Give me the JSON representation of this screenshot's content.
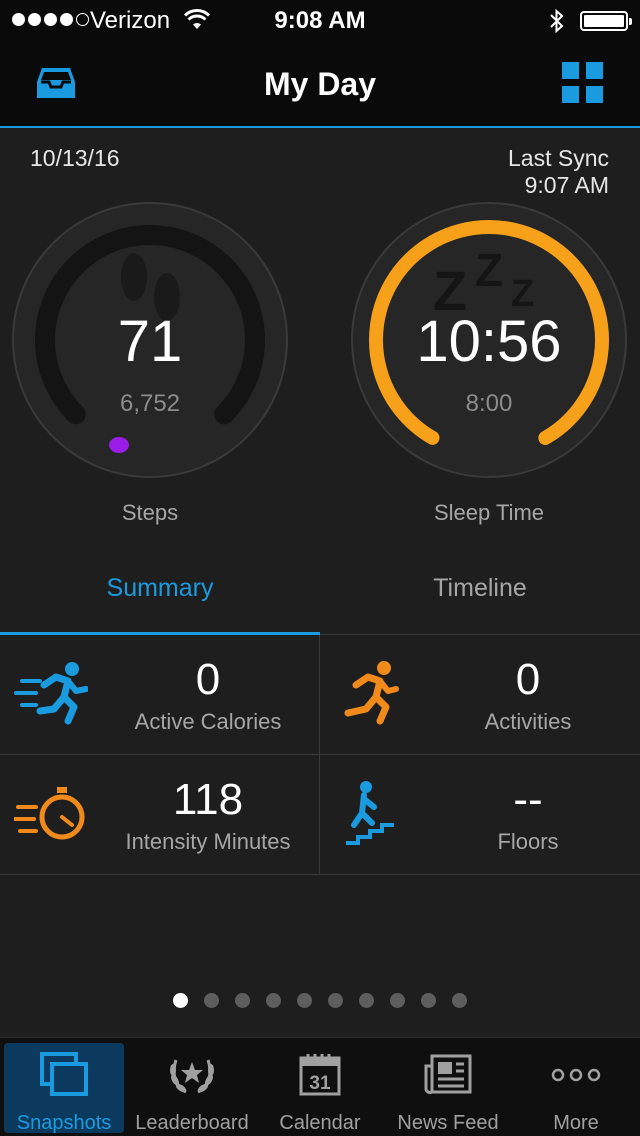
{
  "status_bar": {
    "carrier": "Verizon",
    "time": "9:08 AM",
    "signal_bars": 4,
    "signal_max": 5,
    "battery_level": 1.0
  },
  "nav": {
    "title": "My Day",
    "left_icon": "inbox-icon",
    "right_icon": "grid-icon"
  },
  "header": {
    "date": "10/13/16",
    "sync_label": "Last Sync",
    "sync_time": "9:07 AM"
  },
  "gauges": {
    "steps": {
      "value": "71",
      "goal": "6,752",
      "label": "Steps",
      "progress": 0.0105,
      "icon": "footprints-icon",
      "color": "#9b1ce6"
    },
    "sleep": {
      "value": "10:56",
      "goal": "8:00",
      "label": "Sleep Time",
      "progress": 1.0,
      "icon": "sleep-zzz-icon",
      "color": "#f7a11a"
    }
  },
  "tabs": {
    "summary": "Summary",
    "timeline": "Timeline",
    "active": "summary"
  },
  "stats": [
    {
      "value": "0",
      "label": "Active Calories",
      "icon": "running-fast-icon",
      "color": "#1a9be0"
    },
    {
      "value": "0",
      "label": "Activities",
      "icon": "running-icon",
      "color": "#f08a1a"
    },
    {
      "value": "118",
      "label": "Intensity Minutes",
      "icon": "stopwatch-icon",
      "color": "#f08a1a"
    },
    {
      "value": "--",
      "label": "Floors",
      "icon": "stairs-icon",
      "color": "#1a9be0"
    }
  ],
  "pagination": {
    "count": 10,
    "active_index": 0
  },
  "tab_bar": [
    {
      "label": "Snapshots",
      "icon": "snapshots-icon",
      "active": true
    },
    {
      "label": "Leaderboard",
      "icon": "laurel-icon",
      "active": false
    },
    {
      "label": "Calendar",
      "icon": "calendar-icon",
      "icon_text": "31",
      "active": false
    },
    {
      "label": "News Feed",
      "icon": "newspaper-icon",
      "active": false
    },
    {
      "label": "More",
      "icon": "more-dots-icon",
      "active": false
    }
  ],
  "colors": {
    "accent": "#1a9be0",
    "sleep_ring": "#f7a11a",
    "steps_marker": "#9b1ce6",
    "background": "#1e1e1e"
  }
}
